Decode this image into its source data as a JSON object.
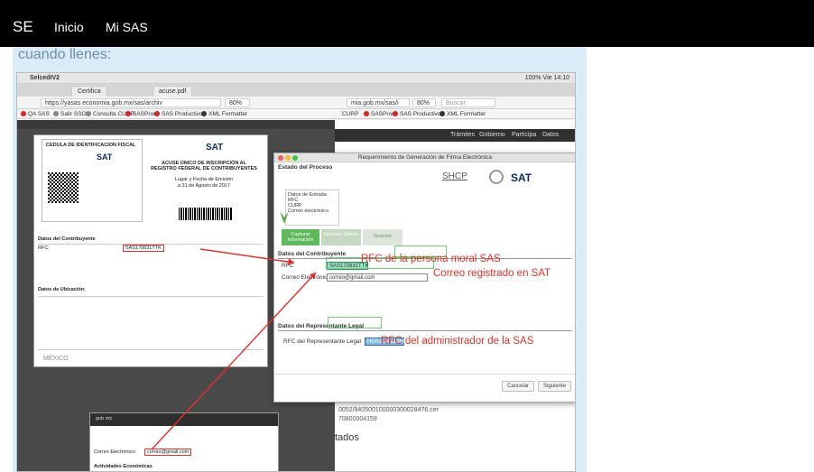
{
  "header": {
    "brand": "SE",
    "nav": [
      "Inicio",
      "Mi SAS"
    ]
  },
  "page": {
    "subtitle": "cuando llenes:"
  },
  "screenshot": {
    "mac_app": "SelcedIV2",
    "mac_status": "100% Vie 14:10",
    "tabs": [
      "Certifica",
      "acuse.pdf"
    ],
    "url_left": "https://yasas.economia.gob.mx/sas/archiv",
    "url_right": "mia.gob.mx/sas/i",
    "zoom_left": "80%",
    "zoom_right": "80%",
    "search_placeholder": "Buscar",
    "bookmarks_left": [
      "QA SAS",
      "Salir SSO",
      "Consulta CURP",
      "SASProd",
      "SAS Productivo",
      "XML Formatter"
    ],
    "bookmarks_right": [
      "CURP",
      "SASProd",
      "SAS Productivo",
      "XML Formatter"
    ],
    "right_nav": [
      "Trámites",
      "Gobierno",
      "Participa",
      "Datos"
    ],
    "pdf": {
      "cedula_title": "CEDULA DE IDENTIFICACION FISCAL",
      "acuse_title": "ACUSE ÚNICO DE INSCRIPCIÓN AL REGISTRO FEDERAL DE CONTRIBUYENTES",
      "lugar_fecha": "Lugar y Fecha de Emisión",
      "fecha": "a 31 de Agosto de 2017",
      "datos_contribuyente": "Datos del Contribuyente",
      "rfc_label": "RFC:",
      "rfc_value": "SAS170831TTK",
      "datos_ubicacion": "Datos de Ubicación:",
      "correo_label": "Correo Electrónico:",
      "correo_value": "correo@gmail.com",
      "actividades": "Actividades Económicas",
      "mexico": "MÉXICO",
      "gobmx": "gob mx"
    },
    "dialog": {
      "title": "Requerimiento de Generación de Firma Electrónica",
      "estado_proceso": "Estado del Proceso",
      "shcp": "SHCP",
      "sat": "SAT",
      "datos_entrada": "Datos de Entrada",
      "datos_entrada_items": [
        "RFC",
        "CURP",
        "Correo electrónico"
      ],
      "steps": [
        "Capturar Información",
        "Generar Claves",
        "Guardar"
      ],
      "datos_contribuyente": "Datos del Contribuyente",
      "rfc_label": "RFC",
      "rfc_value": "SAS170831TTK",
      "correo_label": "Correo Electrónico",
      "correo_value": "correo@gmail.com",
      "datos_representante": "Datos del Representante Legal",
      "rfc_rep_label": "RFC del Representante Legal",
      "rfc_rep_value": "HERJ860513HM1",
      "cancel": "Cancelar",
      "next": "Siguiente"
    },
    "background_text": {
      "hash1": "0052/940500100000300028476.cer",
      "hash2": "70800004159",
      "tados": "tados"
    },
    "callouts": {
      "rfc": "RFC de la persona moral SAS",
      "correo": "Correo registrado en SAT",
      "rfc_admin": "RFC del administrador de la SAS"
    }
  },
  "colors": {
    "callout": "#e0302a",
    "highlight_box": "#6fce74",
    "page_bg": "#d9ecf8"
  }
}
